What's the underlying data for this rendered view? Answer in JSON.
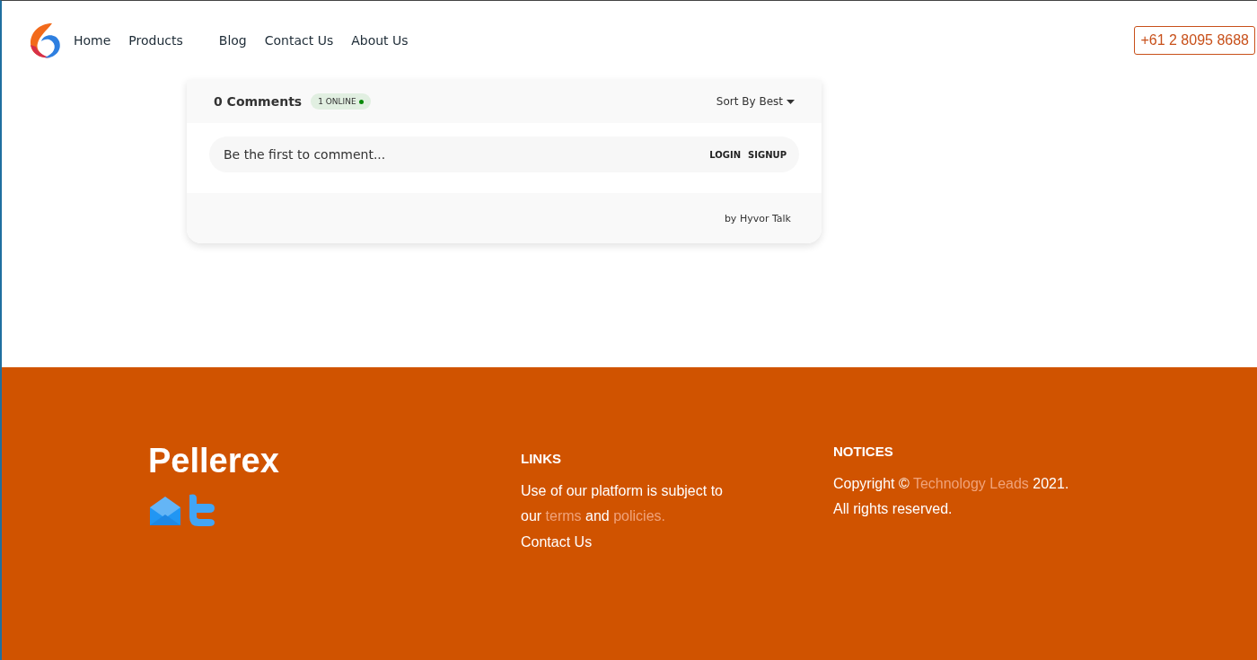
{
  "nav": {
    "items": [
      {
        "label": "Home"
      },
      {
        "label": "Products"
      },
      {
        "label": "Blog"
      },
      {
        "label": "Contact Us"
      },
      {
        "label": "About Us"
      }
    ],
    "phone": "+61 2 8095 8688"
  },
  "comments": {
    "count": "0 Comments",
    "online": "1 ONLINE",
    "sort": "Sort By Best",
    "placeholder": "Be the first to comment...",
    "login": "LOGIN",
    "signup": "SIGNUP",
    "credit": "by Hyvor Talk"
  },
  "footer": {
    "brand": "Pellerex",
    "links_heading": "LINKS",
    "policy": [
      {
        "kind": "text",
        "text": "Use of our platform is subject to our "
      },
      {
        "kind": "link",
        "text": "terms"
      },
      {
        "kind": "text",
        "text": " and "
      },
      {
        "kind": "link",
        "text": "policies."
      }
    ],
    "contact": "Contact Us",
    "notices_heading": "NOTICES",
    "notices": [
      [
        {
          "kind": "text",
          "text": "Copyright © "
        },
        {
          "kind": "link",
          "text": "Technology Leads"
        },
        {
          "kind": "text",
          "text": " 2021."
        }
      ],
      [
        {
          "kind": "text",
          "text": "All rights reserved."
        }
      ]
    ]
  }
}
